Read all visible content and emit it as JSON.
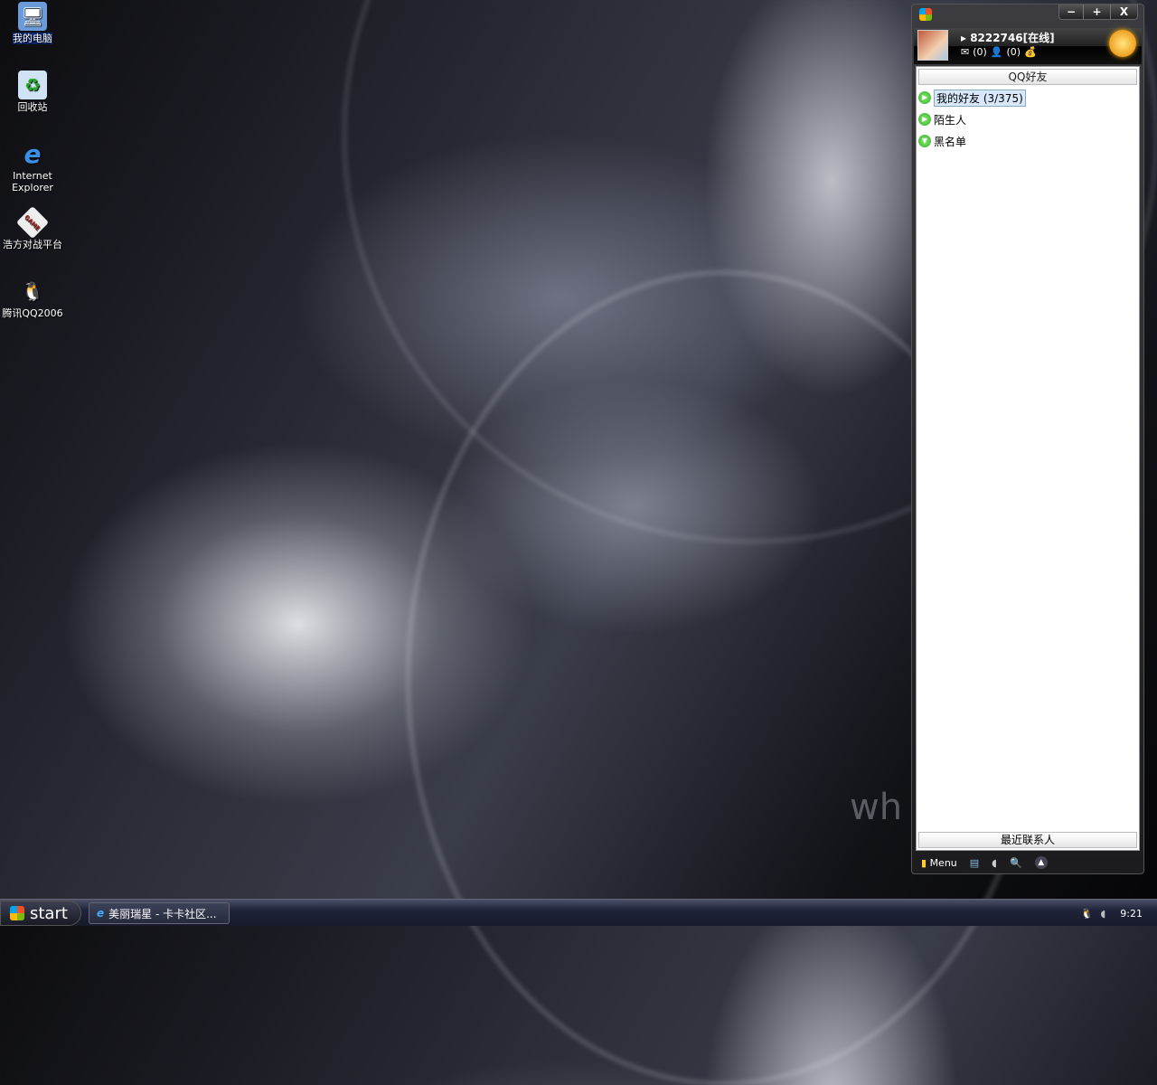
{
  "desktop": {
    "icons": [
      {
        "label": "我的电脑",
        "icon": "computer-icon"
      },
      {
        "label": "回收站",
        "icon": "recycle-bin-icon"
      },
      {
        "label": "Internet Explorer",
        "icon": "ie-icon"
      },
      {
        "label": "浩方对战平台",
        "icon": "game-icon"
      },
      {
        "label": "腾讯QQ2006",
        "icon": "qq-penguin-icon"
      }
    ],
    "watermark": "wh"
  },
  "qq": {
    "title_buttons": {
      "minimize": "−",
      "maximize": "+",
      "close": "X"
    },
    "user": "8222746[在线]",
    "mail_count": "(0)",
    "contacts_count": "(0)",
    "tab_header": "QQ好友",
    "groups": [
      {
        "label": "我的好友 (3/375)",
        "expanded": false
      },
      {
        "label": "陌生人",
        "expanded": false
      },
      {
        "label": "黑名单",
        "expanded": true
      }
    ],
    "recent_contacts": "最近联系人",
    "menu_label": "Menu"
  },
  "taskbar": {
    "start": "start",
    "task": "美丽瑞星 - 卡卡社区...",
    "clock": "9:21"
  }
}
